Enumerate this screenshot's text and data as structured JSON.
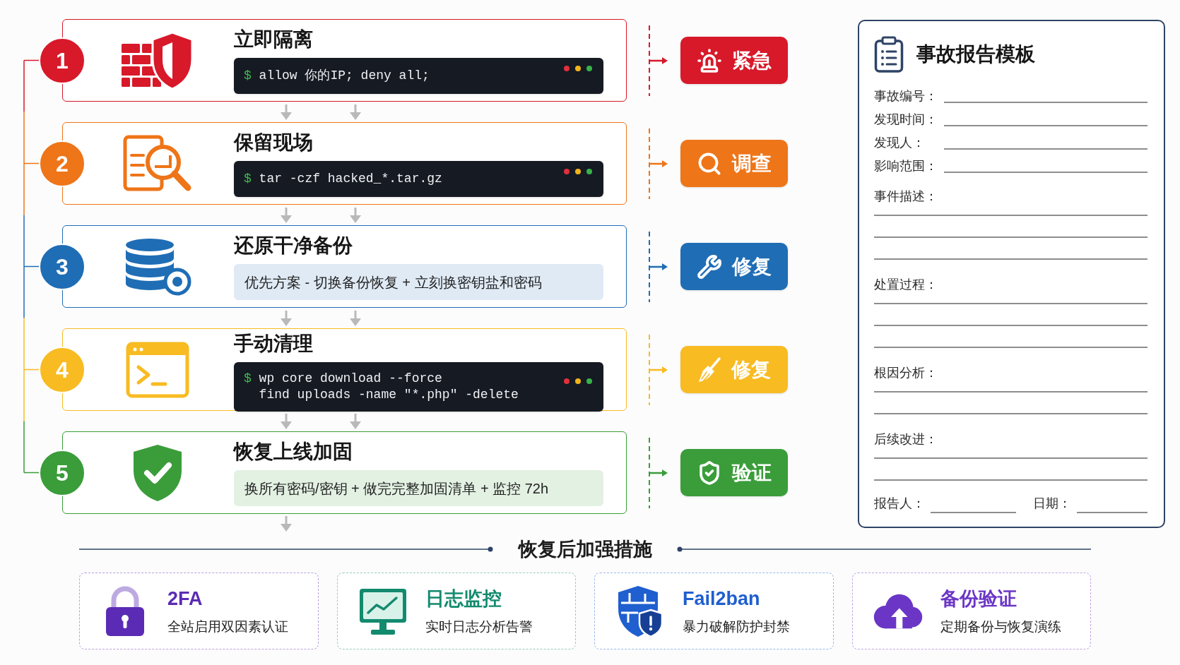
{
  "steps": [
    {
      "number": "1",
      "title": "立即隔离",
      "color": "#d7192a",
      "detail": {
        "kind": "code",
        "lines": [
          {
            "prompt": "$",
            "text": "allow 你的IP; deny all;"
          }
        ]
      },
      "tag": {
        "label": "紧急"
      }
    },
    {
      "number": "2",
      "title": "保留现场",
      "color": "#ee7518",
      "detail": {
        "kind": "code",
        "lines": [
          {
            "prompt": "$",
            "text": "tar -czf hacked_*.tar.gz"
          }
        ]
      },
      "tag": {
        "label": "调查"
      }
    },
    {
      "number": "3",
      "title": "还原干净备份",
      "color": "#1f6db5",
      "detail": {
        "kind": "note",
        "text": "优先方案 - 切换备份恢复 + 立刻换密钥盐和密码"
      },
      "tag": {
        "label": "修复"
      }
    },
    {
      "number": "4",
      "title": "手动清理",
      "color": "#f8bb22",
      "detail": {
        "kind": "code",
        "lines": [
          {
            "prompt": "$",
            "text": "wp core download --force"
          },
          {
            "text": "find uploads -name \"*.php\" -delete"
          }
        ]
      },
      "tag": {
        "label": "修复"
      }
    },
    {
      "number": "5",
      "title": "恢复上线加固",
      "color": "#3a9d3a",
      "detail": {
        "kind": "note",
        "text": "换所有密码/密钥 + 做完完整加固清单 + 监控 72h"
      },
      "tag": {
        "label": "验证"
      }
    }
  ],
  "report": {
    "title": "事故报告模板",
    "fields": [
      {
        "label": "事故编号：",
        "kind": "line"
      },
      {
        "label": "发现时间：",
        "kind": "line"
      },
      {
        "label": "发现人：",
        "kind": "line"
      },
      {
        "label": "影响范围：",
        "kind": "line"
      },
      {
        "label": "事件描述：",
        "kind": "long"
      },
      {
        "label": "处置过程：",
        "kind": "long"
      },
      {
        "label": "根因分析：",
        "kind": "short"
      },
      {
        "label": "后续改进：",
        "kind": "short"
      }
    ],
    "signoff": [
      {
        "label": "报告人："
      },
      {
        "label": "日期："
      }
    ]
  },
  "section_title": "恢复后加强措施",
  "measures": [
    {
      "title": "2FA",
      "description": "全站启用双因素认证",
      "color": "#5b2bb5"
    },
    {
      "title": "日志监控",
      "description": "实时日志分析告警",
      "color": "#138a6e"
    },
    {
      "title": "Fail2ban",
      "description": "暴力破解防护封禁",
      "color": "#1f5fcf"
    },
    {
      "title": "备份验证",
      "description": "定期备份与恢复演练",
      "color": "#6b36c6"
    }
  ]
}
